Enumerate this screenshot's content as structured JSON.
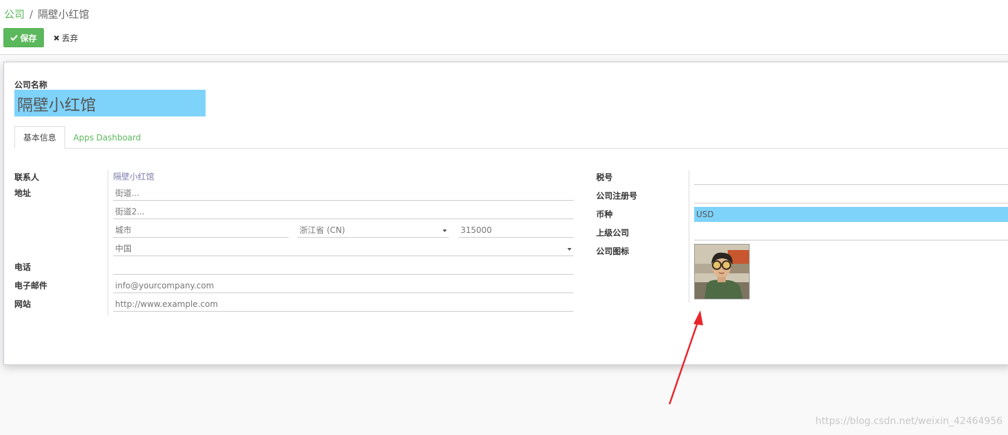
{
  "breadcrumb": {
    "parent": "公司",
    "separator": "/",
    "current": "隔壁小红馆"
  },
  "toolbar": {
    "save_label": "保存",
    "discard_label": "丢弃"
  },
  "form": {
    "company_name_label": "公司名称",
    "company_name_value": "隔壁小红馆",
    "tabs": [
      {
        "label": "基本信息",
        "active": true
      },
      {
        "label": "Apps Dashboard",
        "active": false
      }
    ],
    "left": {
      "contact_label": "联系人",
      "contact_value": "隔壁小红馆",
      "address_label": "地址",
      "street_placeholder": "街道...",
      "street2_placeholder": "街道2...",
      "city_placeholder": "城市",
      "state_value": "浙江省 (CN)",
      "zip_value": "315000",
      "country_value": "中国",
      "phone_label": "电话",
      "phone_value": "",
      "email_label": "电子邮件",
      "email_placeholder": "info@yourcompany.com",
      "website_label": "网站",
      "website_placeholder": "http://www.example.com"
    },
    "right": {
      "tax_id_label": "税号",
      "company_registry_label": "公司注册号",
      "currency_label": "币种",
      "currency_value": "USD",
      "parent_company_label": "上级公司",
      "logo_label": "公司图标"
    }
  },
  "colors": {
    "accent_green": "#5cb85c",
    "highlight_blue": "#7ed3fa",
    "annotation_red": "#e8262b"
  },
  "watermark": "https://blog.csdn.net/weixin_42464956"
}
